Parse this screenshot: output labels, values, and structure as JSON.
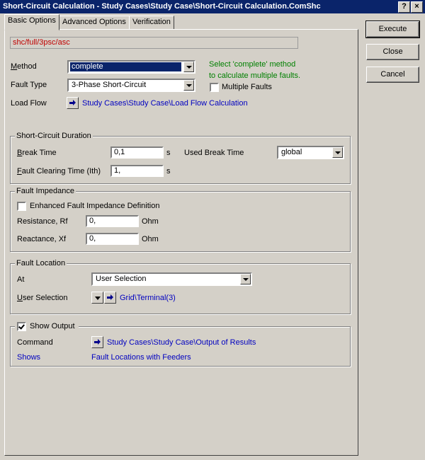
{
  "window": {
    "title": "Short-Circuit Calculation - Study Cases\\Study Case\\Short-Circuit Calculation.ComShc",
    "help_glyph": "?",
    "close_glyph": "×"
  },
  "tabs": [
    "Basic Options",
    "Advanced Options",
    "Verification"
  ],
  "buttons": {
    "execute": "Execute",
    "close": "Close",
    "cancel": "Cancel"
  },
  "command_path": "shc/full/3psc/asc",
  "basic": {
    "method_label": "Method",
    "method_value": "complete",
    "method_hint_1": "Select 'complete' method",
    "method_hint_2": "to calculate multiple faults.",
    "fault_type_label": "Fault Type",
    "fault_type_value": "3-Phase Short-Circuit",
    "multiple_faults_label": "Multiple Faults",
    "multiple_faults_checked": false,
    "load_flow_label": "Load Flow",
    "load_flow_link": "Study Cases\\Study Case\\Load Flow Calculation"
  },
  "duration": {
    "legend": "Short-Circuit Duration",
    "break_time_label_key": "B",
    "break_time_label_rest": "reak Time",
    "break_time_value": "0,1",
    "break_time_unit": "s",
    "used_break_time_label": "Used Break Time",
    "used_break_time_value": "global",
    "clearing_label_key": "F",
    "clearing_label_rest": "ault Clearing Time (Ith)",
    "clearing_value": "1,",
    "clearing_unit": "s"
  },
  "impedance": {
    "legend": "Fault Impedance",
    "enhanced_label": "Enhanced Fault Impedance Definition",
    "enhanced_checked": false,
    "resistance_label": "Resistance, Rf",
    "resistance_value": "0,",
    "resistance_unit": "Ohm",
    "reactance_label": "Reactance, Xf",
    "reactance_value": "0,",
    "reactance_unit": "Ohm"
  },
  "location": {
    "legend": "Fault Location",
    "at_label": "At",
    "at_value": "User Selection",
    "user_selection_label_key": "U",
    "user_selection_label_rest": "ser Selection",
    "user_selection_link": "Grid\\Terminal(3)"
  },
  "output": {
    "show_output_label": "Show Output",
    "show_output_checked": true,
    "command_label": "Command",
    "command_link": "Study Cases\\Study Case\\Output of Results",
    "shows_label": "Shows",
    "shows_value": "Fault Locations with Feeders"
  }
}
